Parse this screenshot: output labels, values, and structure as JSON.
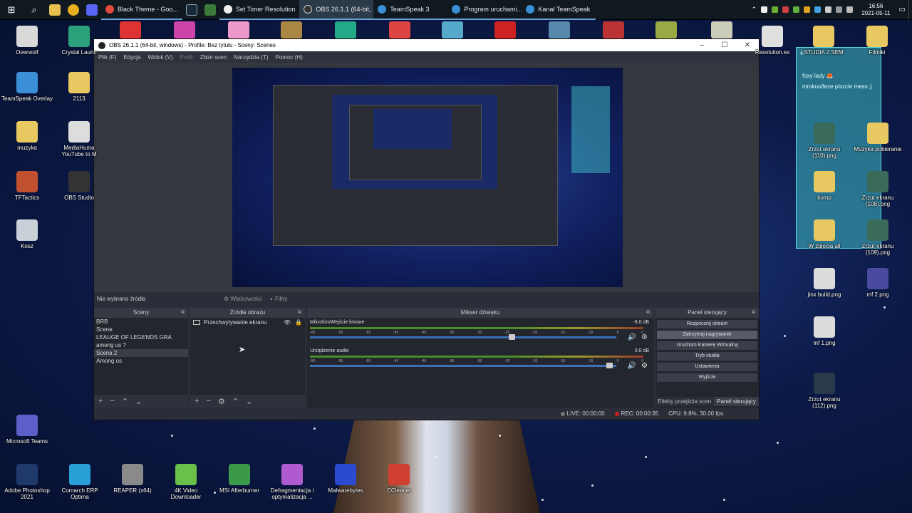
{
  "taskbar": {
    "tasks": [
      {
        "label": "Black Theme - Goo...",
        "icon": "chrome-icon"
      },
      {
        "label": "Set Timer Resolution",
        "icon": "clock-icon"
      },
      {
        "label": "OBS 26.1.1 (64-bit, ...",
        "icon": "obs-icon"
      },
      {
        "label": "TeamSpeak 3",
        "icon": "teamspeak-icon"
      },
      {
        "label": "Program uruchami...",
        "icon": "app-icon"
      },
      {
        "label": "Kanał TeamSpeak",
        "icon": "app-icon"
      }
    ],
    "time": "16:56",
    "date": "2021-05-11"
  },
  "desktop_left": [
    {
      "label": "Overwolf",
      "icon": "overwolf-icon",
      "color": "#d9d9d9"
    },
    {
      "label": "TeamSpeak Overlay",
      "icon": "teamspeak-icon",
      "color": "#3a8fd6"
    },
    {
      "label": "muzyka",
      "icon": "folder-icon",
      "color": "#e8c860"
    },
    {
      "label": "TFTactics",
      "icon": "tft-icon",
      "color": "#c05030"
    },
    {
      "label": "Kosz",
      "icon": "recycle-bin-icon",
      "color": "#c8d0d8"
    },
    {
      "label": "Microsoft Teams",
      "icon": "teams-icon",
      "color": "#5b5fc7"
    }
  ],
  "desktop_col2": [
    {
      "label": "Crystal Launc",
      "icon": "crystal-icon",
      "color": "#2aa17a"
    },
    {
      "label": "2113",
      "icon": "folder-icon",
      "color": "#e8c860"
    },
    {
      "label": "MediaHuma YouTube to M",
      "icon": "mediahuman-icon",
      "color": "#dddddd"
    },
    {
      "label": "OBS Studio",
      "icon": "obs-icon",
      "color": "#333333"
    }
  ],
  "desktop_bottom": [
    {
      "label": "Adobe Photoshop 2021",
      "icon": "photoshop-icon",
      "color": "#1f3a6a"
    },
    {
      "label": "Comarch ERP Optima",
      "icon": "comarch-icon",
      "color": "#2aa0d8"
    },
    {
      "label": "REAPER (x64)",
      "icon": "reaper-icon",
      "color": "#8a8a8a"
    },
    {
      "label": "4K Video Downloader",
      "icon": "download-icon",
      "color": "#6ac04a"
    },
    {
      "label": "MSI Afterburner",
      "icon": "msi-icon",
      "color": "#3a9a4a"
    },
    {
      "label": "Defragmentacja i optymalizacja ...",
      "icon": "defrag-icon",
      "color": "#b05ad0"
    },
    {
      "label": "Malwarebytes",
      "icon": "malwarebytes-icon",
      "color": "#2a4ad0"
    },
    {
      "label": "CCleaner",
      "icon": "ccleaner-icon",
      "color": "#d04030"
    }
  ],
  "desktop_right": [
    {
      "label": "Resolution.ex",
      "icon": "clock-icon",
      "color": "#e0e0e0"
    },
    {
      "label": "STUDIA 2 SEM",
      "icon": "folder-icon",
      "color": "#e8c860"
    },
    {
      "label": "Filmiki",
      "icon": "folder-icon",
      "color": "#e8c860"
    },
    {
      "label": "Zrzut ekranu (110).png",
      "icon": "image-icon",
      "color": "#3a6a5a"
    },
    {
      "label": "Muzyka pobieranie",
      "icon": "folder-icon",
      "color": "#e8c860"
    },
    {
      "label": "komp",
      "icon": "folder-icon",
      "color": "#e8c860"
    },
    {
      "label": "Zrzut ekranu (108).png",
      "icon": "image-icon",
      "color": "#3a6a5a"
    },
    {
      "label": "W zdjecia all",
      "icon": "folder-icon",
      "color": "#e8c860"
    },
    {
      "label": "Zrzut ekranu (109).png",
      "icon": "image-icon",
      "color": "#3a6a5a"
    },
    {
      "label": "jinx build.png",
      "icon": "image-icon",
      "color": "#dcdcdc"
    },
    {
      "label": "mf 2.png",
      "icon": "image-icon",
      "color": "#4a4aa0"
    },
    {
      "label": "mf 1.png",
      "icon": "image-icon",
      "color": "#dcdcdc"
    },
    {
      "label": "Zrzut ekranu (112).png",
      "icon": "image-icon",
      "color": "#2a3a4a"
    }
  ],
  "sticky_note": {
    "lines": [
      "foxy lady 🦊",
      "mrokuu/leze piszcie mess ;j"
    ]
  },
  "obs": {
    "title": "OBS 26.1.1 (64-bit, windows) - Profile: Bez tytułu - Sceny: Scenes",
    "menu": [
      "Plik (F)",
      "Edycja",
      "Widok (V)",
      "Profil",
      "Zbiór scen",
      "Narzędzia (T)",
      "Pomoc (H)"
    ],
    "no_source": "Nie wybrano źródła",
    "properties": "Właściwości",
    "filters": "Filtry",
    "scenes_title": "Sceny",
    "scenes": [
      "BRB",
      "Scene",
      "LEAUGE OF LEGENDS GRA",
      "among us ?",
      "Scena 2",
      "Among us"
    ],
    "selected_scene_index": 4,
    "sources_title": "Źródła obrazu",
    "sources": [
      "Przechwytywanie ekranu"
    ],
    "mixer_title": "Mikser dźwięku",
    "tracks": [
      {
        "name": "Mikrofon/Wejście liniowe",
        "db": "-8.0 dB",
        "level": 0.66
      },
      {
        "name": "Urządzenie audio",
        "db": "0.0 dB",
        "level": 0.98
      }
    ],
    "ticks": [
      "-60",
      "-55",
      "-50",
      "-45",
      "-40",
      "-35",
      "-30",
      "-25",
      "-20",
      "-15",
      "-10",
      "-5",
      "0"
    ],
    "controls_title": "Panel sterujący",
    "controls": [
      "Rozpocznij stream",
      "Zatrzymaj nagrywanie",
      "Uruchom Kamerę Wirtualną",
      "Tryb studia",
      "Ustawienia",
      "Wyjście"
    ],
    "tabs": [
      "Efekty przejścia scen",
      "Panel sterujący"
    ],
    "status": {
      "live": "LIVE: 00:00:00",
      "rec": "REC: 00:00:35",
      "cpu": "CPU: 9.8%, 30.00 fps"
    }
  },
  "colors": {
    "accent": "#3b6fb8",
    "rec": "#d02020",
    "panel": "#24262e"
  }
}
